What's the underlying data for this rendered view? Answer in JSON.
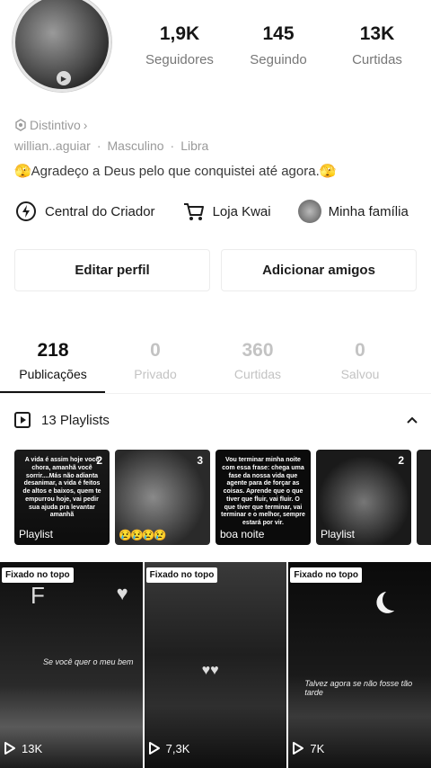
{
  "profile": {
    "stats": [
      {
        "value": "1,9K",
        "label": "Seguidores"
      },
      {
        "value": "145",
        "label": "Seguindo"
      },
      {
        "value": "13K",
        "label": "Curtidas"
      }
    ],
    "badge": "Distintivo",
    "username": "willian..aguiar",
    "gender": "Masculino",
    "sign": "Libra",
    "bio": "🫣Agradeço a Deus pelo que conquistei até agora.🫣"
  },
  "links": [
    {
      "label": "Central do Criador",
      "icon": "lightning-circle-icon"
    },
    {
      "label": "Loja Kwai",
      "icon": "cart-icon"
    },
    {
      "label": "Minha família",
      "icon": "family-avatar-icon"
    }
  ],
  "actions": {
    "edit": "Editar perfil",
    "add_friends": "Adicionar amigos"
  },
  "tabs": [
    {
      "count": "218",
      "label": "Publicações"
    },
    {
      "count": "0",
      "label": "Privado"
    },
    {
      "count": "360",
      "label": "Curtidas"
    },
    {
      "count": "0",
      "label": "Salvou"
    }
  ],
  "playlists": {
    "header": "13 Playlists",
    "items": [
      {
        "count": "2",
        "caption": "Playlist",
        "text": "A vida é assim hoje você chora, amanhã você sorrir....Más não adianta desanimar, a vida é feitos de altos e baixos, quem te empurrou hoje, vai pedir sua ajuda pra levantar amanhã"
      },
      {
        "count": "3",
        "caption": "",
        "text": ""
      },
      {
        "count": "",
        "caption": "boa noite",
        "text": "Vou terminar minha noite com essa frase: chega uma fase da nossa vida que agente para de forçar as coisas. Aprende que o que tiver que fluir, vai fluir. O que tiver que terminar, vai terminar e o melhor, sempre estará por vir."
      },
      {
        "count": "2",
        "caption": "Playlist",
        "text": ""
      }
    ]
  },
  "posts": [
    {
      "pinned": "Fixado no topo",
      "views": "13K",
      "overlay": "Se você quer o meu bem",
      "letter": "F"
    },
    {
      "pinned": "Fixado no topo",
      "views": "7,3K",
      "overlay": "",
      "letter": ""
    },
    {
      "pinned": "Fixado no topo",
      "views": "7K",
      "overlay": "Talvez agora se não fosse tão tarde",
      "letter": ""
    }
  ]
}
